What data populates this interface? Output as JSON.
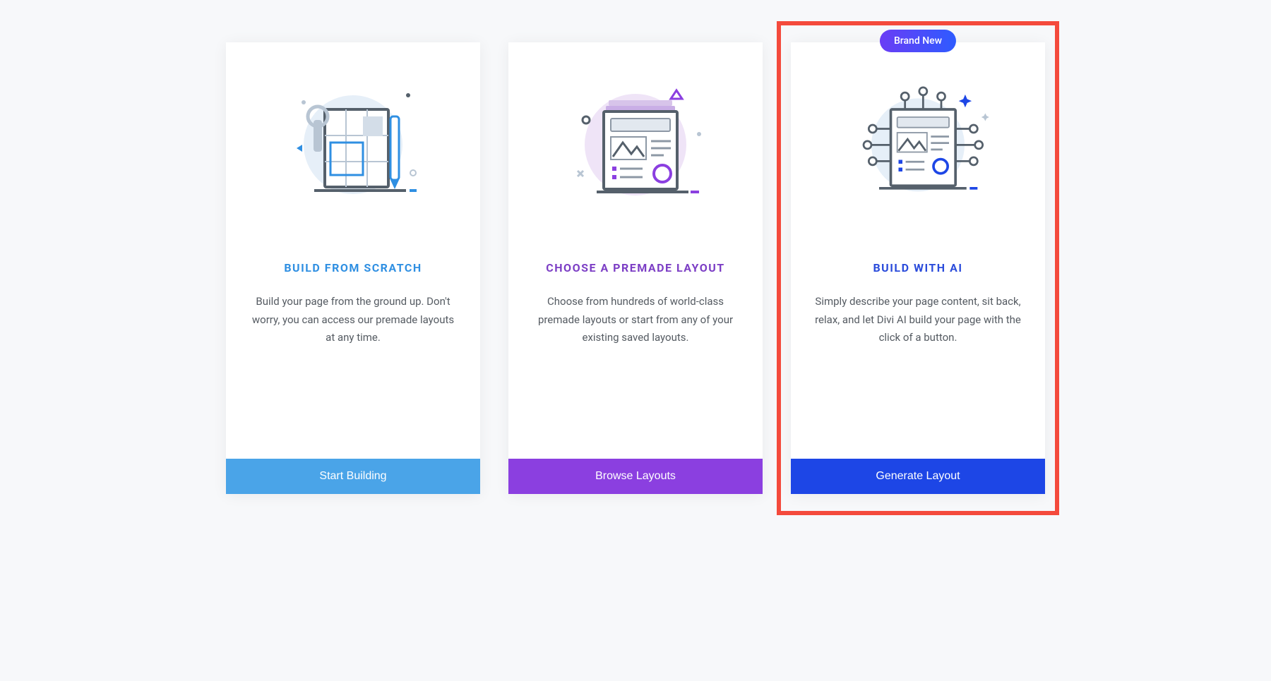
{
  "cards": [
    {
      "title": "BUILD FROM SCRATCH",
      "desc": "Build your page from the ground up. Don't worry, you can access our premade layouts at any time.",
      "cta": "Start Building"
    },
    {
      "title": "CHOOSE A PREMADE LAYOUT",
      "desc": "Choose from hundreds of world-class premade layouts or start from any of your existing saved layouts.",
      "cta": "Browse Layouts"
    },
    {
      "title": "BUILD WITH AI",
      "desc": "Simply describe your page content, sit back, relax, and let Divi AI build your page with the click of a button.",
      "cta": "Generate Layout",
      "badge": "Brand New"
    }
  ],
  "colors": {
    "blue": "#4aa4e8",
    "purple": "#8b3fe0",
    "ai": "#1d46e6",
    "highlight": "#f44a3c"
  }
}
